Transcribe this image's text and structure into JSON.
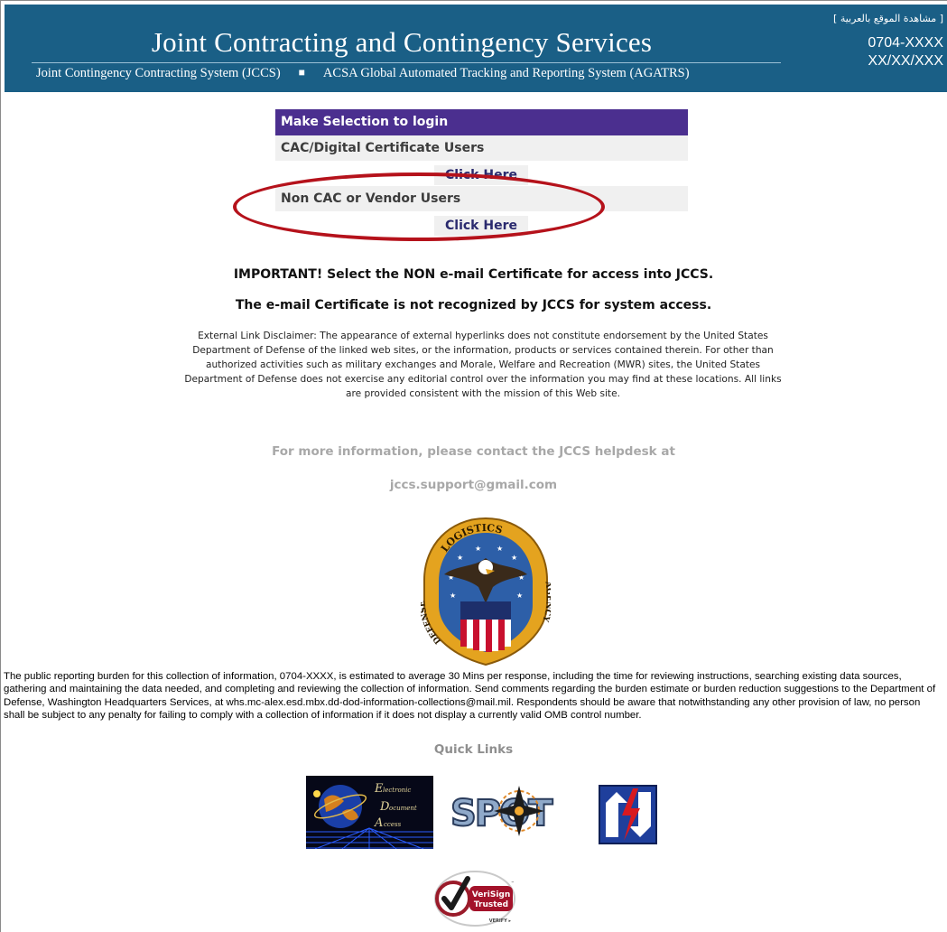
{
  "header": {
    "title": "Joint Contracting and Contingency Services",
    "subtitle_left": "Joint Contingency Contracting System (JCCS)",
    "subtitle_sep": "■",
    "subtitle_right": "ACSA Global Automated Tracking and Reporting System (AGATRS)",
    "language_link": "[ مشاهدة الموقع بالعربية ]",
    "control_number": "0704-XXXX",
    "expiration_date": "XX/XX/XXX"
  },
  "login": {
    "heading": "Make Selection to login",
    "options": [
      {
        "label": "CAC/Digital Certificate Users",
        "button": "Click Here"
      },
      {
        "label": "Non CAC or Vendor Users",
        "button": "Click Here"
      }
    ]
  },
  "notices": {
    "important_1": "IMPORTANT! Select the NON e-mail Certificate for access into JCCS.",
    "important_2": "The e-mail Certificate is not recognized by JCCS for system access.",
    "disclaimer": "External Link Disclaimer: The appearance of external hyperlinks does not constitute endorsement by the United States Department of Defense of the linked web sites, or the information, products or services contained therein. For other than authorized activities such as military exchanges and Morale, Welfare and Recreation (MWR) sites, the United States Department of Defense does not exercise any editorial control over the information you may find at these locations. All links are provided consistent with the mission of this Web site."
  },
  "helpdesk": {
    "line1": "For more information, please contact the JCCS helpdesk at",
    "email": "jccs.support@gmail.com"
  },
  "seal": {
    "top_text": "LOGISTICS",
    "left_text": "DEFENSE",
    "right_text": "AGENCY"
  },
  "burden_statement": "The public reporting burden for this collection of information, 0704-XXXX, is estimated to average 30 Mins per response, including the time for reviewing instructions, searching existing data sources, gathering and maintaining the data needed, and completing and reviewing the collection of information. Send comments regarding the burden estimate or burden reduction suggestions to the Department of Defense, Washington Headquarters Services, at whs.mc-alex.esd.mbx.dd-dod-information-collections@mail.mil. Respondents should be aware that notwithstanding any other provision of law, no person shall be subject to any penalty for failing to comply with a collection of information if it does not display a currently valid OMB control number.",
  "quick_links": {
    "title": "Quick Links",
    "eda_logo_letters": [
      "E",
      "lectronic",
      "D",
      "ocument",
      "A",
      "ccess"
    ],
    "spot_logo_text": "SPOT",
    "verisign": {
      "line1": "VeriSign",
      "line2": "Trusted",
      "line3": "VERIFY ▸",
      "tm": "™"
    }
  },
  "colors": {
    "banner": "#1a5f86",
    "login_heading": "#4b2f8f",
    "highlight": "#b5121b",
    "helpdesk_text": "#a8a8a8"
  }
}
